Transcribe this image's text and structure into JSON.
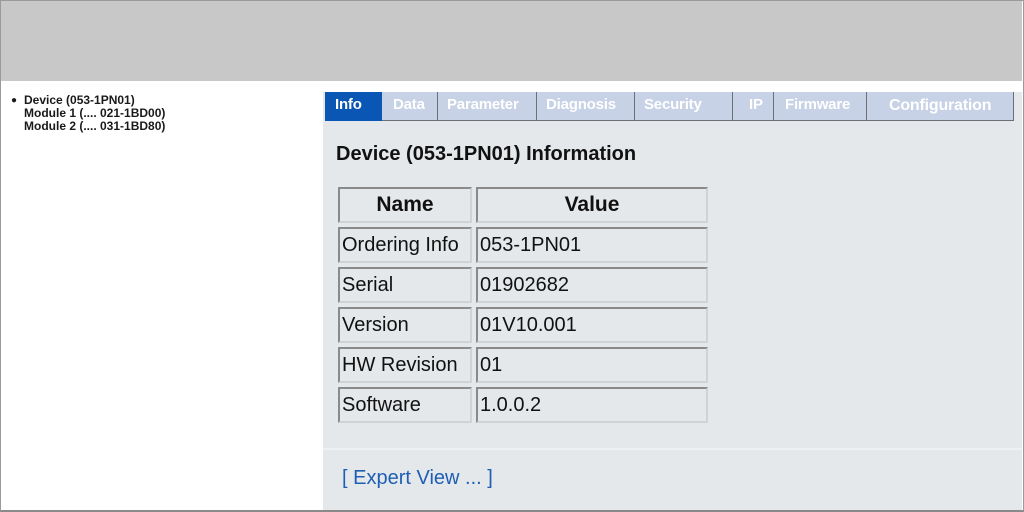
{
  "sidebar": {
    "items": [
      {
        "label": "Device (053-1PN01)",
        "selected": true
      },
      {
        "label": "Module 1 (.... 021-1BD00)",
        "selected": false
      },
      {
        "label": "Module 2 (.... 031-1BD80)",
        "selected": false
      }
    ]
  },
  "tabs": [
    {
      "label": "Info",
      "active": true
    },
    {
      "label": "Data",
      "active": false
    },
    {
      "label": "Parameter",
      "active": false
    },
    {
      "label": "Diagnosis",
      "active": false
    },
    {
      "label": "Security",
      "active": false
    },
    {
      "label": "IP",
      "active": false
    },
    {
      "label": "Firmware",
      "active": false
    },
    {
      "label": "Configuration",
      "active": false
    }
  ],
  "main": {
    "title": "Device (053-1PN01) Information",
    "table": {
      "headers": [
        "Name",
        "Value"
      ],
      "rows": [
        [
          "Ordering Info",
          "053-1PN01"
        ],
        [
          "Serial",
          "01902682"
        ],
        [
          "Version",
          "01V10.001"
        ],
        [
          "HW Revision",
          "01"
        ],
        [
          "Software",
          "1.0.0.2"
        ]
      ]
    },
    "expert_link": "[ Expert View ... ]"
  },
  "colors": {
    "header_bg": "#c8c8c8",
    "active_tab": "#0a56b4",
    "inactive_tab": "#c7d2e6",
    "content_bg": "#e4e8eb",
    "link": "#1e5fb4"
  }
}
